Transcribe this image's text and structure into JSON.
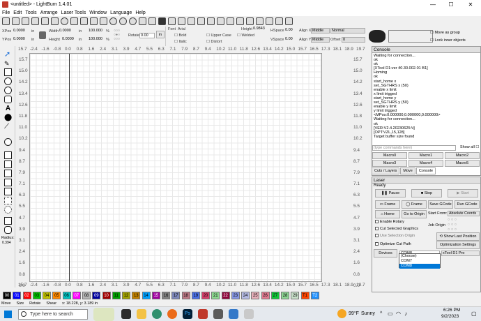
{
  "window": {
    "title": "<untitled> - LightBurn 1.4.01",
    "minimize": "—",
    "maximize": "☐",
    "close": "✕"
  },
  "menu": [
    "File",
    "Edit",
    "Tools",
    "Arrange",
    "Laser Tools",
    "Window",
    "Language",
    "Help"
  ],
  "props": {
    "xpos_label": "XPos",
    "xpos": "0.0000",
    "ypos_label": "YPos",
    "ypos": "0.0000",
    "unit": "in",
    "width_label": "Width",
    "width": "0.0000",
    "height_label": "Height",
    "height": "0.0000",
    "scale_w": "100.000",
    "scale_h": "100.000",
    "pct": "%",
    "rotate_label": "Rotate",
    "rotate": "0.00",
    "rot_unit": "in",
    "font_label": "Font",
    "font": "Arial",
    "bold": "Bold",
    "italic": "Italic",
    "upper_case": "Upper Case",
    "distort": "Distort",
    "welded": "Welded",
    "height_text_label": "Height",
    "height_text": "0.9843",
    "hspace_label": "HSpace",
    "hspace": "0.00",
    "vspace_label": "VSpace",
    "vspace": "0.00",
    "alignx_label": "Align X",
    "alignx": "Middle",
    "aligny_label": "Align Y",
    "aligny": "Middle",
    "normal": "Normal",
    "offset_label": "Offset",
    "offset": "0",
    "move_as_group": "Move as group",
    "lock_inner": "Lock inner objects"
  },
  "ruler_top": [
    "15.7",
    "-2.4",
    "-1.6",
    "-0.8",
    "0.0",
    "0.8",
    "1.6",
    "2.4",
    "3.1",
    "3.9",
    "4.7",
    "5.5",
    "6.3",
    "7.1",
    "7.9",
    "8.7",
    "9.4",
    "10.2",
    "11.0",
    "11.8",
    "12.6",
    "13.4",
    "14.2",
    "15.0",
    "15.7",
    "16.5",
    "17.3",
    "18.1",
    "18.9",
    "19.7"
  ],
  "ruler_bottom": [
    "15.7",
    "-2.4",
    "-1.6",
    "-0.8",
    "0.0",
    "0.8",
    "1.6",
    "2.4",
    "3.1",
    "3.9",
    "4.7",
    "5.5",
    "6.3",
    "7.1",
    "7.9",
    "8.7",
    "9.4",
    "10.2",
    "11.0",
    "11.8",
    "12.6",
    "13.4",
    "14.2",
    "15.0",
    "15.7",
    "16.5",
    "17.3",
    "18.1",
    "18.9",
    "19.7"
  ],
  "ruler_left": [
    "15.7",
    "15.0",
    "14.2",
    "13.4",
    "12.6",
    "11.8",
    "11.0",
    "10.2",
    "9.4",
    "8.7",
    "7.9",
    "7.1",
    "6.3",
    "5.5",
    "4.7",
    "3.9",
    "3.1",
    "2.4",
    "1.6",
    "0.8",
    "0.0"
  ],
  "ruler_right": [
    "15.7",
    "15.0",
    "14.2",
    "13.4",
    "12.6",
    "11.8",
    "11.0",
    "10.2",
    "9.4",
    "8.7",
    "7.9",
    "7.1",
    "6.3",
    "5.5",
    "4.7",
    "3.9",
    "3.1",
    "2.4",
    "1.6",
    "0.8",
    "0.0"
  ],
  "radius": {
    "label": "Radius:",
    "value": "0.394"
  },
  "console": {
    "title": "Console",
    "log": "Waiting for connection...\nok\nok\n[XTool D1:ver 40.30.002.01 B1]\nHoming\nok\nstart_home x\nset_SGTHRS x (50)\nenable x limit\nx limit trigged\nstart_home y\nset_SGTHRS y (50)\nenable y limit\ny limit trigged\n<MPos:0.000000,0.000000,0.000000>\nWaiting for connection...\nok\n[VER:V2.4.20230625:\\t]\n[OPT:VZL,15,128]\nTarget buffer size found",
    "cmd_placeholder": "(type commands here)",
    "show_all": "Show all"
  },
  "macros": [
    "Macro0",
    "Macro1",
    "Macro2",
    "Macro3",
    "Macro4",
    "Macro5"
  ],
  "tabs": [
    "Cuts / Layers",
    "Move",
    "Console"
  ],
  "laser": {
    "title": "Laser",
    "status": "Ready",
    "pause": "Pause",
    "stop": "Stop",
    "start": "Start",
    "frame1": "Frame",
    "frame2": "Frame",
    "save_gcode": "Save GCode",
    "run_gcode": "Run GCode",
    "home": "Home",
    "go_to_origin": "Go to Origin",
    "start_from_label": "Start From:",
    "start_from": "Absolute Coords",
    "enable_rotary": "Enable Rotary",
    "job_origin": "Job Origin",
    "cut_selected": "Cut Selected Graphics",
    "use_selection_origin": "Use Selection Origin",
    "show_last_position": "Show Last Position",
    "optimize_cut_path": "Optimize Cut Path",
    "optimization_settings": "Optimization Settings",
    "devices": "Devices",
    "port": "COM8",
    "device": "xTool D1 Pro",
    "port_options": [
      "(Choose)",
      "COM7",
      "COM8"
    ]
  },
  "palette": [
    {
      "l": "00",
      "c": "#000000",
      "t": "#ffffff"
    },
    {
      "l": "01",
      "c": "#0000ff",
      "t": "#ffffff"
    },
    {
      "l": "02",
      "c": "#ff0000",
      "t": "#ffffff"
    },
    {
      "l": "03",
      "c": "#00c000",
      "t": "#000000"
    },
    {
      "l": "04",
      "c": "#c0c000",
      "t": "#000000"
    },
    {
      "l": "05",
      "c": "#ff8800",
      "t": "#000000"
    },
    {
      "l": "06",
      "c": "#00c0c0",
      "t": "#000000"
    },
    {
      "l": "07",
      "c": "#ff00ff",
      "t": "#ffffff"
    },
    {
      "l": "08",
      "c": "#b4b4b4",
      "t": "#000000"
    },
    {
      "l": "09",
      "c": "#0000a0",
      "t": "#ffffff"
    },
    {
      "l": "10",
      "c": "#a00000",
      "t": "#ffffff"
    },
    {
      "l": "11",
      "c": "#00a000",
      "t": "#000000"
    },
    {
      "l": "12",
      "c": "#a0a000",
      "t": "#000000"
    },
    {
      "l": "13",
      "c": "#c08000",
      "t": "#000000"
    },
    {
      "l": "14",
      "c": "#00a0ff",
      "t": "#000000"
    },
    {
      "l": "15",
      "c": "#a000a0",
      "t": "#ffffff"
    },
    {
      "l": "16",
      "c": "#808080",
      "t": "#000000"
    },
    {
      "l": "17",
      "c": "#7d87b9",
      "t": "#000000"
    },
    {
      "l": "18",
      "c": "#bb7784",
      "t": "#000000"
    },
    {
      "l": "19",
      "c": "#4a6fe3",
      "t": "#000000"
    },
    {
      "l": "20",
      "c": "#d33f6a",
      "t": "#000000"
    },
    {
      "l": "21",
      "c": "#8cd78f",
      "t": "#000000"
    },
    {
      "l": "22",
      "c": "#8e063b",
      "t": "#ffffff"
    },
    {
      "l": "23",
      "c": "#8595e1",
      "t": "#000000"
    },
    {
      "l": "24",
      "c": "#b5bbe3",
      "t": "#000000"
    },
    {
      "l": "25",
      "c": "#e6afb9",
      "t": "#000000"
    },
    {
      "l": "26",
      "c": "#e07b91",
      "t": "#000000"
    },
    {
      "l": "27",
      "c": "#11c638",
      "t": "#000000"
    },
    {
      "l": "28",
      "c": "#8dd593",
      "t": "#000000"
    },
    {
      "l": "29",
      "c": "#c6dec7",
      "t": "#000000"
    },
    {
      "l": "T1",
      "c": "#ff4500",
      "t": "#000000"
    },
    {
      "l": "T2",
      "c": "#1e90ff",
      "t": "#ffffff"
    }
  ],
  "status": {
    "move": "Move",
    "size": "Size",
    "rotate": "Rotate",
    "shear": "Shear",
    "coords": "x: 18.228, y: 3.189 in"
  },
  "taskbar": {
    "search": "Type here to search",
    "weather_temp": "99°F",
    "weather_desc": "Sunny",
    "time": "6:26 PM",
    "date": "9/2/2023"
  }
}
